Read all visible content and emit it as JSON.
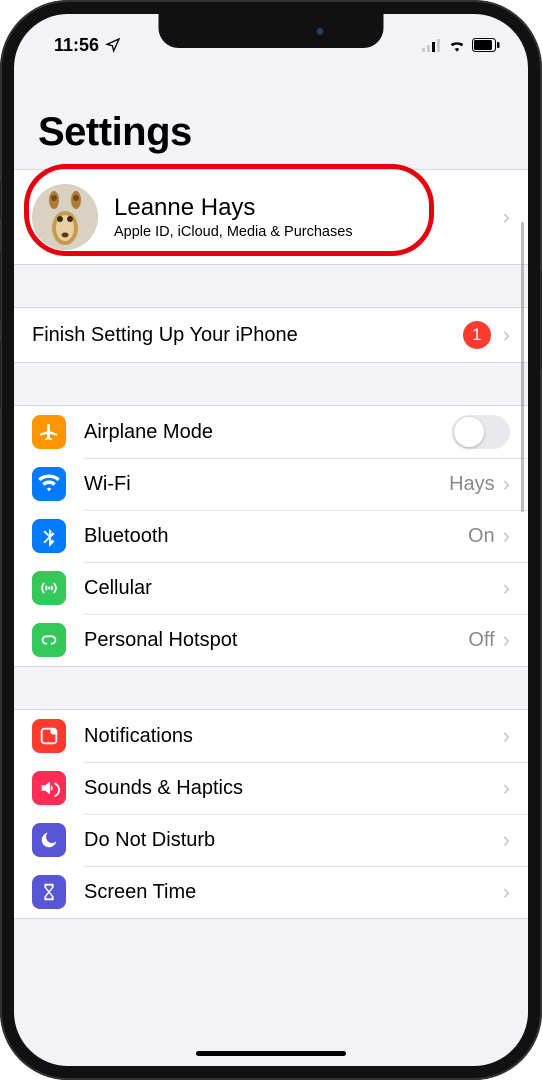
{
  "status": {
    "time": "11:56",
    "location_icon": "location-arrow"
  },
  "page_title": "Settings",
  "profile": {
    "name": "Leanne Hays",
    "subtitle": "Apple ID, iCloud, Media & Purchases",
    "highlighted": true
  },
  "setup": {
    "label": "Finish Setting Up Your iPhone",
    "badge": "1"
  },
  "group_network": [
    {
      "icon": "airplane",
      "color": "#ff9500",
      "label": "Airplane Mode",
      "control": "toggle",
      "toggle_on": false
    },
    {
      "icon": "wifi",
      "color": "#007aff",
      "label": "Wi-Fi",
      "value": "Hays"
    },
    {
      "icon": "bluetooth",
      "color": "#007aff",
      "label": "Bluetooth",
      "value": "On"
    },
    {
      "icon": "cellular",
      "color": "#34c759",
      "label": "Cellular",
      "value": ""
    },
    {
      "icon": "hotspot",
      "color": "#34c759",
      "label": "Personal Hotspot",
      "value": "Off"
    }
  ],
  "group_notifications": [
    {
      "icon": "notifications",
      "color": "#ff3b30",
      "label": "Notifications"
    },
    {
      "icon": "sounds",
      "color": "#ff2d55",
      "label": "Sounds & Haptics"
    },
    {
      "icon": "dnd",
      "color": "#5856d6",
      "label": "Do Not Disturb"
    },
    {
      "icon": "screentime",
      "color": "#5856d6",
      "label": "Screen Time"
    }
  ]
}
